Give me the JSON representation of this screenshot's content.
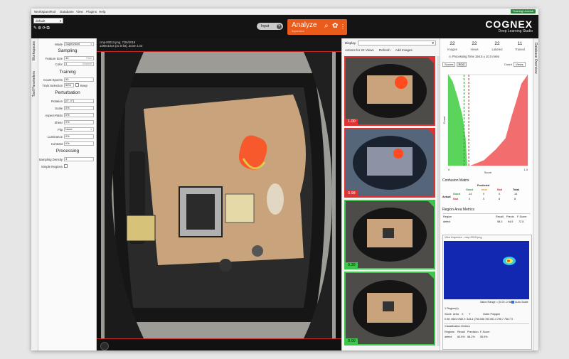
{
  "menubar": {
    "items": [
      "Workspace",
      "Tool",
      "Database",
      "View",
      "Plugins",
      "Help"
    ],
    "license": "Training License"
  },
  "toolbar": {
    "workspace_value": "default",
    "input_label": "Input",
    "analyze_label": "Analyze",
    "analyze_sub": "Supervised",
    "brand_name": "COGNEX",
    "brand_sub": "Deep Learning Studio"
  },
  "side_tabs": {
    "workspaces": "Workspaces",
    "tool_parameters": "Tool Parameters",
    "database_overview": "Database Overview"
  },
  "params": {
    "mode_label": "Mode",
    "mode_value": "Supervised",
    "sampling_title": "Sampling",
    "feature_size_label": "Feature Size",
    "feature_size_value": "40",
    "feature_size_unit": "Pixel",
    "color_label": "Color",
    "color_value": "3",
    "color_unit": "Channel",
    "training_title": "Training",
    "count_epochs_label": "Count Epochs",
    "count_epochs_value": "50",
    "train_selection_label": "Train Selection",
    "train_selection_value": "50%",
    "keep_label": "Keep",
    "perturbation_title": "Perturbation",
    "rotation_label": "Rotation",
    "rotation_value": "[0°, 0°]",
    "scale_label": "Scale",
    "scale_value": "0%",
    "aspect_label": "Aspect-Ratio",
    "aspect_value": "0%",
    "shear_label": "Shear",
    "shear_value": "0%",
    "flip_label": "Flip",
    "flip_value": "None",
    "luminance_label": "Luminance",
    "luminance_value": "0%",
    "contrast_label": "Contrast",
    "contrast_value": "0%",
    "processing_title": "Processing",
    "sampling_density_label": "Sampling Density",
    "sampling_density_value": "3",
    "simple_regions_label": "Simple Regions"
  },
  "viewer": {
    "filename": "cmp-00013.png",
    "date": "7/26/2018",
    "info": "1280x1024 (3x 8-bit), Zoom 1.0x"
  },
  "grid": {
    "display_label": "Display",
    "actions": [
      "Actions for 22 Views",
      "Refresh",
      "Add Images"
    ],
    "thumbs": [
      {
        "score": "1.00",
        "status": "bad"
      },
      {
        "score": "0.98",
        "status": "bad"
      },
      {
        "score": "0.39",
        "status": "good"
      },
      {
        "score": "0.00",
        "status": "good"
      }
    ]
  },
  "stats": {
    "counts": [
      {
        "value": "22",
        "label": "Images"
      },
      {
        "value": "22",
        "label": "Views"
      },
      {
        "value": "22",
        "label": "Labeled"
      },
      {
        "value": "11",
        "label": "Trained"
      }
    ],
    "processing_time": "Processing Time 194.5 ± 10.0 ms/vi",
    "tabs": [
      "Scores",
      "ROC"
    ],
    "count_label": "Count",
    "count_value": "Views",
    "chart_ylabel": "Count",
    "chart_xlabel": "Score",
    "x_min": "0",
    "x_max": "1.0",
    "confusion_title": "Confusion Matrix",
    "confusion": {
      "predicted": "Predicted",
      "actual": "Actual",
      "cols": [
        "Good",
        "Inter",
        "Bad",
        "Total"
      ],
      "rows": [
        {
          "label": "Good",
          "vals": [
            "14",
            "0",
            "0",
            "14"
          ]
        },
        {
          "label": "Bad",
          "vals": [
            "0",
            "0",
            "8",
            "8"
          ]
        }
      ]
    },
    "region_title": "Region Area Metrics",
    "region_cols": [
      "Region",
      "Recall",
      "Precis",
      "F-Score"
    ],
    "region_row": [
      "defect",
      "58.0",
      "94.9",
      "72.5"
    ],
    "inspector_title": "View Inspector - cmp-0015.png",
    "value_range": "Value Range = [0.00, 0.98]",
    "auto_scale": "Auto-Scale",
    "regions_count": "1 Region(s)",
    "region_tbl_cols": [
      "Score",
      "Area",
      "X",
      "Y",
      "Outer Polygon"
    ],
    "region_tbl_row": [
      "0.98",
      "4540.0",
      "782.9",
      "343.4",
      "[760.548 760.551.4 756.7 756.7 5"
    ],
    "class_title": "Classification Metrics",
    "class_cols": [
      "Regions",
      "Recall",
      "Precision",
      "F-Score"
    ],
    "class_row": [
      "defect",
      "60.5%",
      "68.2%",
      "55.5%"
    ]
  },
  "chart_data": {
    "type": "area",
    "xlabel": "Score",
    "ylabel": "Count",
    "xlim": [
      0,
      1.0
    ],
    "series": [
      {
        "name": "Good",
        "color": "#5bd45b",
        "x": [
          0.0,
          0.02,
          0.06,
          0.12,
          0.18,
          0.22,
          0.24
        ],
        "y": [
          1.0,
          0.98,
          0.92,
          0.75,
          0.55,
          0.3,
          0.0
        ]
      },
      {
        "name": "Bad",
        "color": "#f26d6d",
        "x": [
          0.28,
          0.45,
          0.6,
          0.72,
          0.8,
          0.86,
          0.92,
          1.0
        ],
        "y": [
          0.0,
          0.06,
          0.18,
          0.3,
          0.55,
          0.72,
          0.9,
          1.0
        ]
      }
    ],
    "thresholds": [
      0.2,
      0.26
    ]
  },
  "colors": {
    "accent": "#ea5b1c",
    "bad": "#d33333",
    "good": "#3cc74a",
    "license": "#2e8b3d"
  }
}
